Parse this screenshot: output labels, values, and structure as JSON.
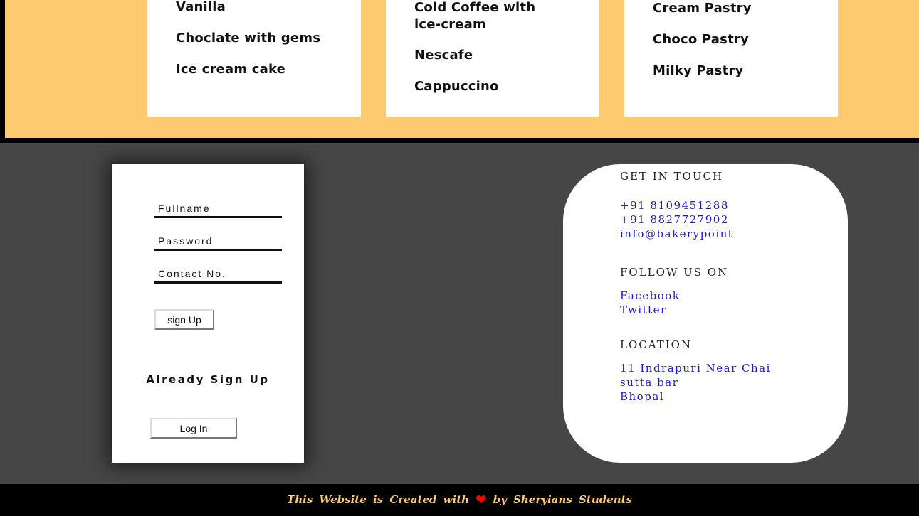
{
  "menu": {
    "columns": [
      {
        "items": [
          "Vanilla",
          "Choclate with gems",
          "Ice cream cake"
        ]
      },
      {
        "items": [
          "Cold Coffee with ice-cream",
          "Nescafe",
          "Cappuccino"
        ]
      },
      {
        "items": [
          "Cream Pastry",
          "Choco Pastry",
          "Milky Pastry"
        ]
      }
    ]
  },
  "signup": {
    "fullname_placeholder": "Fullname",
    "password_placeholder": "Password",
    "contact_placeholder": "Contact No.",
    "signup_button": "sign Up",
    "already_text": "Already Sign Up",
    "login_button": "Log In"
  },
  "contact": {
    "touch_heading": "GET IN TOUCH",
    "phone1": "+91 8109451288",
    "phone2": "+91 8827727902",
    "email": "info@bakerypoint",
    "follow_heading": "FOLLOW US ON",
    "facebook": "Facebook",
    "twitter": "Twitter",
    "location_heading": "LOCATION",
    "address_line1": "11 Indrapuri Near Chai",
    "address_line2": "sutta bar",
    "address_line3": "Bhopal"
  },
  "footer": {
    "text_before": "This Website is Created with",
    "text_after": "by Sheryians Students",
    "heart_icon": "heart-icon"
  },
  "colors": {
    "accent_yellow": "#fdca6f",
    "panel_gray": "#464646",
    "link_blue": "#1a1ad6",
    "heart_red": "#ff0000"
  }
}
